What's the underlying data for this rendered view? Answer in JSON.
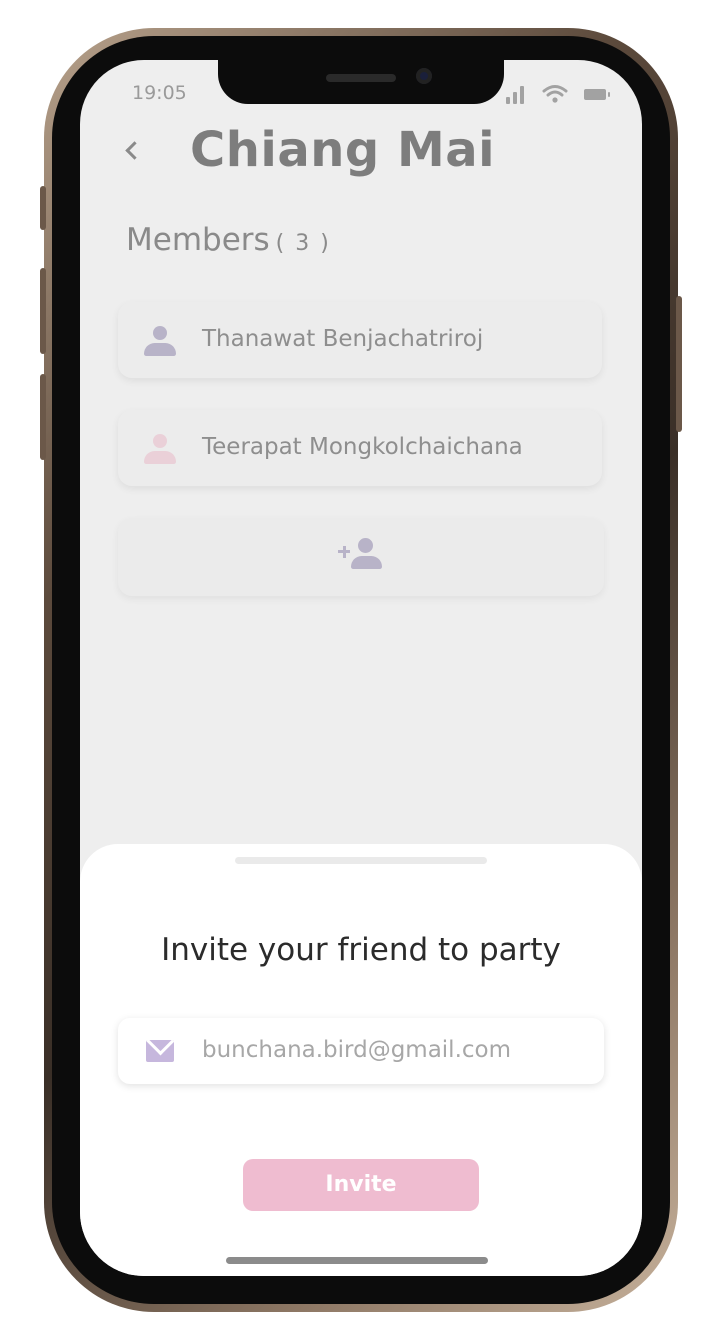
{
  "status_bar": {
    "time": "19:05",
    "icons": [
      "signal-icon",
      "wifi-icon",
      "battery-icon"
    ]
  },
  "header": {
    "back_icon": "chevron-left-icon",
    "title": "Chiang Mai"
  },
  "members": {
    "heading": "Members",
    "count": "( 3 )",
    "items": [
      {
        "name": "Thanawat Benjachatriroj",
        "icon": "person-icon",
        "color": "#b8b3c8"
      },
      {
        "name": "Teerapat Mongkolchaichana",
        "icon": "person-icon",
        "color": "#ead0d8"
      }
    ],
    "add_icon": "add-person-icon"
  },
  "invite_sheet": {
    "title": "Invite your friend to party",
    "email_icon": "mail-icon",
    "email_value": "bunchana.bird@gmail.com",
    "button_label": "Invite"
  },
  "colors": {
    "accent_purple": "#c6b7dd",
    "accent_pink": "#efbcd0",
    "screen_bg": "#eeeeee"
  }
}
